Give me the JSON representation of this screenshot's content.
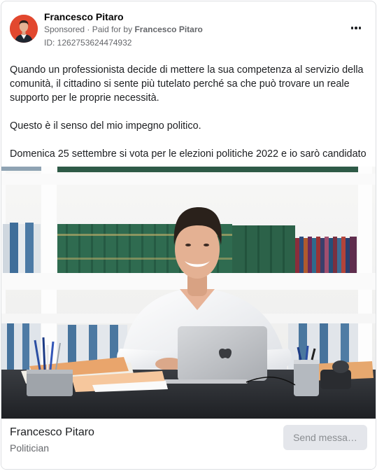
{
  "post": {
    "page_name": "Francesco Pitaro",
    "sponsored_label": "Sponsored",
    "paid_for_prefix": "Paid for by",
    "paid_for_name": "Francesco Pitaro",
    "ad_id": "ID: 1262753624474932",
    "more_icon": "more-horizontal-icon",
    "paragraphs": [
      "Quando un professionista decide di mettere la sua competenza al servizio della comunità, il cittadino si sente più tutelato perché sa che può trovare un reale supporto per le proprie necessità.",
      "Questo è il senso del mio impegno politico.",
      "Domenica 25 settembre si vota per le elezioni politiche 2022 e io sarò candidato …"
    ]
  },
  "footer": {
    "name": "Francesco Pitaro",
    "category": "Politician",
    "send_button_label": "Send messa…"
  },
  "colors": {
    "secondary_text": "#65676b",
    "button_bg": "#e4e6eb",
    "button_text": "#8a8d91",
    "avatar_bg": "#e2482f"
  }
}
